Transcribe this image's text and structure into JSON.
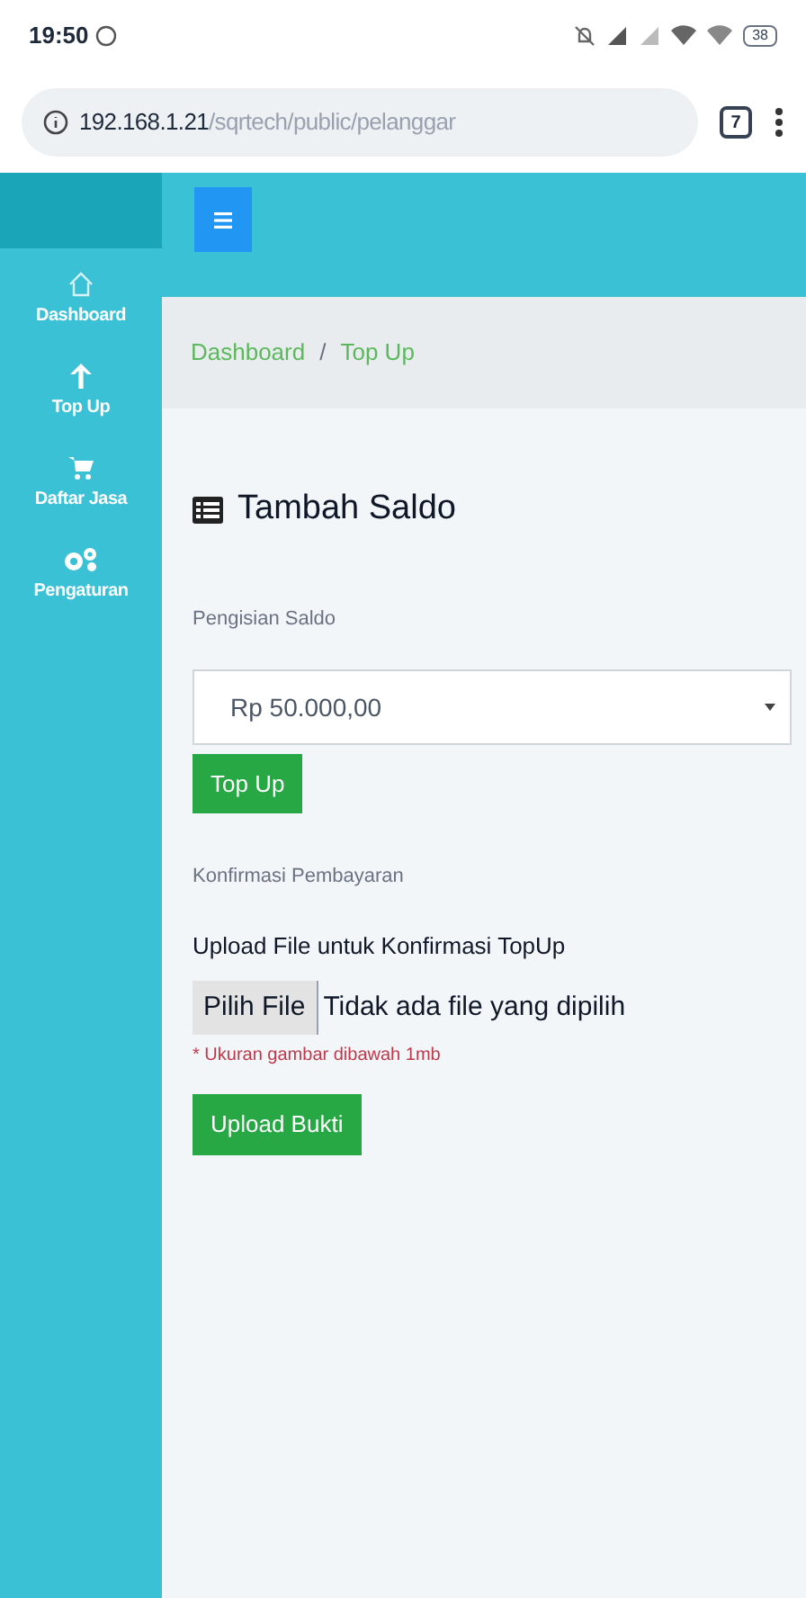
{
  "status_bar": {
    "time": "19:50",
    "battery": "38"
  },
  "browser": {
    "url_host": "192.168.1.21",
    "url_path": "/sqrtech/public/pelanggar",
    "tab_count": "7"
  },
  "sidebar": {
    "items": [
      {
        "label": "Dashboard",
        "kind": "home"
      },
      {
        "label": "Top Up",
        "kind": "upload"
      },
      {
        "label": "Daftar Jasa",
        "kind": "shop"
      },
      {
        "label": "Pengaturan",
        "kind": "settings"
      }
    ]
  },
  "breadcrumb": {
    "items": [
      "Dashboard",
      "Top Up"
    ],
    "separator": "/"
  },
  "page_title": "Tambah Saldo",
  "saldo": {
    "label": "Pengisian Saldo",
    "value": "Rp 50.000,00",
    "button": "Top Up"
  },
  "konfirmasi": {
    "label": "Konfirmasi Pembayaran",
    "upload_label": "Upload File untuk Konfirmasi TopUp",
    "file_button": "Pilih File",
    "file_status": "Tidak ada file yang dipilih",
    "note": "* Ukuran gambar dibawah 1mb",
    "button": "Upload Bukti"
  }
}
